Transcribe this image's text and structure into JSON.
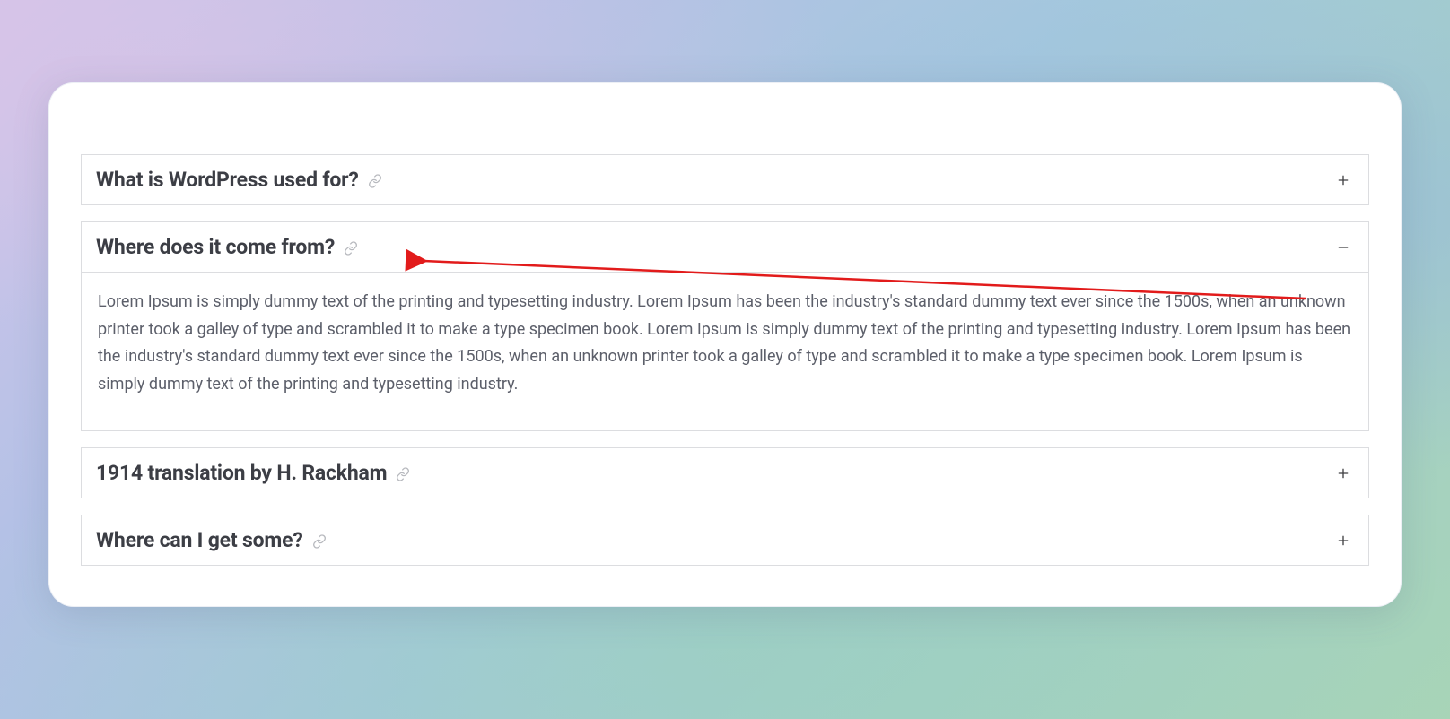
{
  "accordion": {
    "items": [
      {
        "title": "What is WordPress used for?",
        "expanded": false,
        "content": ""
      },
      {
        "title": "Where does it come from?",
        "expanded": true,
        "content": "Lorem Ipsum is simply dummy text of the printing and typesetting industry. Lorem Ipsum has been the industry's standard dummy text ever since the 1500s, when an unknown printer took a galley of type and scrambled it to make a type specimen book. Lorem Ipsum is simply dummy text of the printing and typesetting industry. Lorem Ipsum has been the industry's standard dummy text ever since the 1500s, when an unknown printer took a galley of type and scrambled it to make a type specimen book. Lorem Ipsum is simply dummy text of the printing and typesetting industry."
      },
      {
        "title": "1914 translation by H. Rackham",
        "expanded": false,
        "content": ""
      },
      {
        "title": "Where can I get some?",
        "expanded": false,
        "content": ""
      }
    ]
  },
  "annotation": {
    "arrow_color": "#e21b1b"
  }
}
